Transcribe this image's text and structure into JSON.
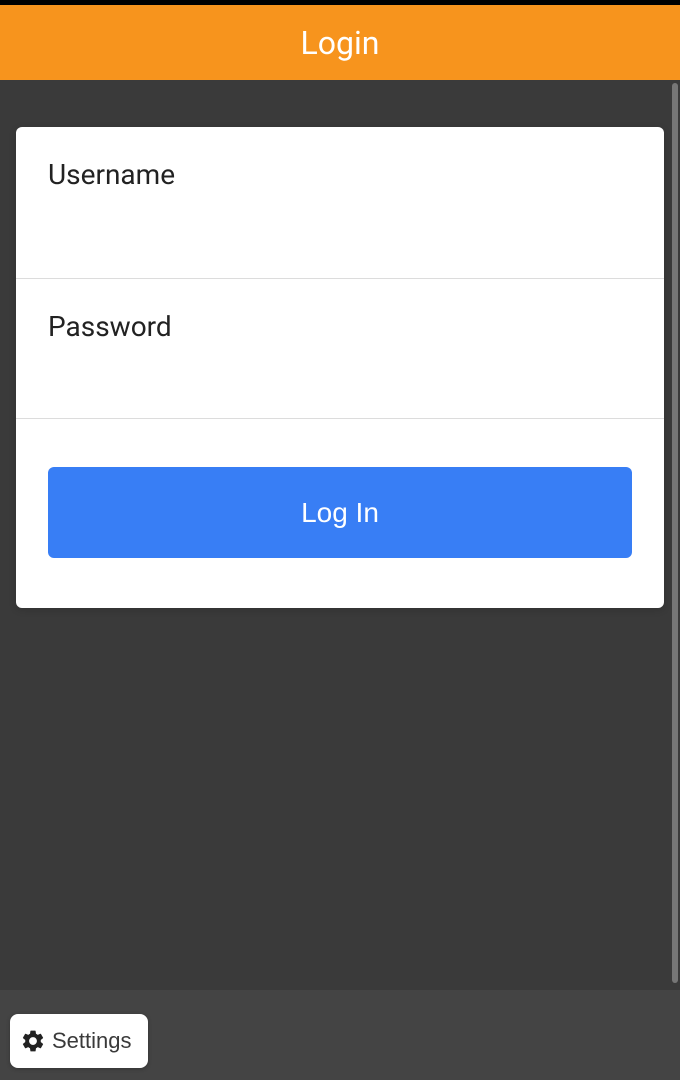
{
  "header": {
    "title": "Login"
  },
  "form": {
    "username": {
      "label": "Username",
      "value": ""
    },
    "password": {
      "label": "Password",
      "value": ""
    },
    "submit_label": "Log In"
  },
  "footer": {
    "settings_label": "Settings"
  }
}
